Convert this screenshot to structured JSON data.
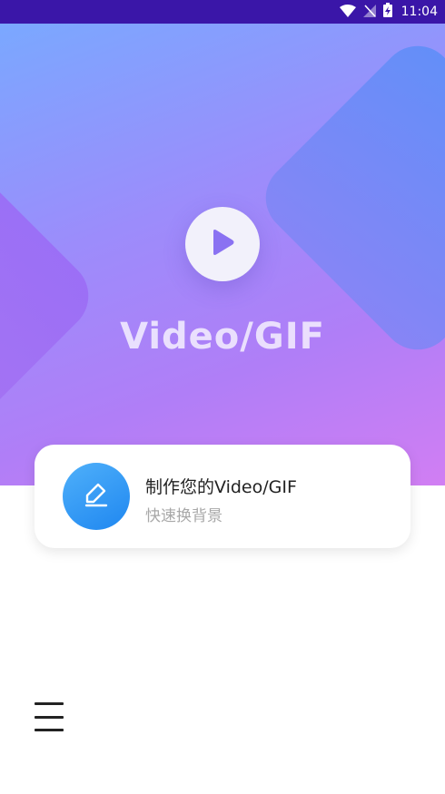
{
  "status_bar": {
    "time": "11:04",
    "icons": [
      "wifi-icon",
      "no-signal-icon",
      "battery-charging-icon"
    ]
  },
  "hero": {
    "play_icon": "play-icon",
    "title": "Video/GIF"
  },
  "card": {
    "icon": "edit-pen-icon",
    "title": "制作您的Video/GIF",
    "subtitle": "快速换背景"
  },
  "menu": {
    "icon": "hamburger-menu-icon"
  },
  "colors": {
    "status_bar": "#3a16a8",
    "card_icon": "#1f87f0",
    "hero_gradient_start": "#7aa8ff",
    "hero_gradient_end": "#d17ef3"
  }
}
